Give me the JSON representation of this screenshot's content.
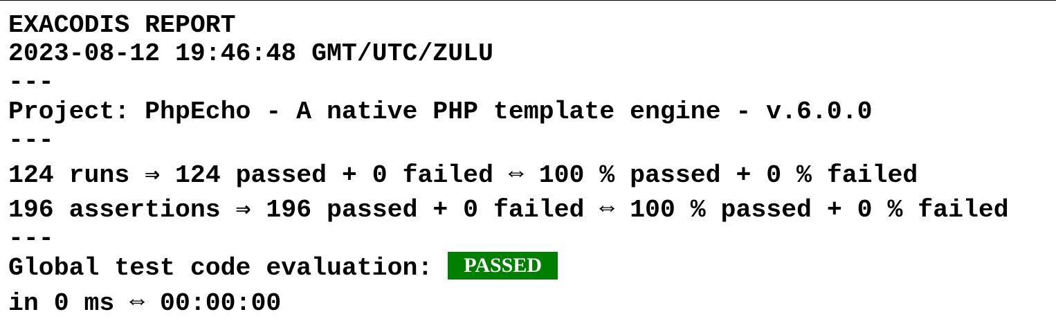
{
  "report": {
    "heading": "EXACODIS REPORT",
    "timestamp": "2023-08-12 19:46:48 GMT/UTC/ZULU",
    "separator": "---",
    "project": "Project: PhpEcho - A native PHP template engine - v.6.0.0",
    "runs_summary": "124 runs ⇒ 124 passed + 0 failed ⇔ 100 % passed + 0 % failed",
    "assertions_summary": "196 assertions ⇒ 196 passed + 0 failed ⇔ 100 % passed + 0 % failed",
    "evaluation_label": "Global test code evaluation: ",
    "evaluation_status": "PASSED",
    "duration": "in 0 ms ⇔ 00:00:00"
  },
  "colors": {
    "status_passed_bg": "#008000",
    "status_passed_text": "#ffffff",
    "text": "#000000",
    "background": "#ffffff"
  }
}
